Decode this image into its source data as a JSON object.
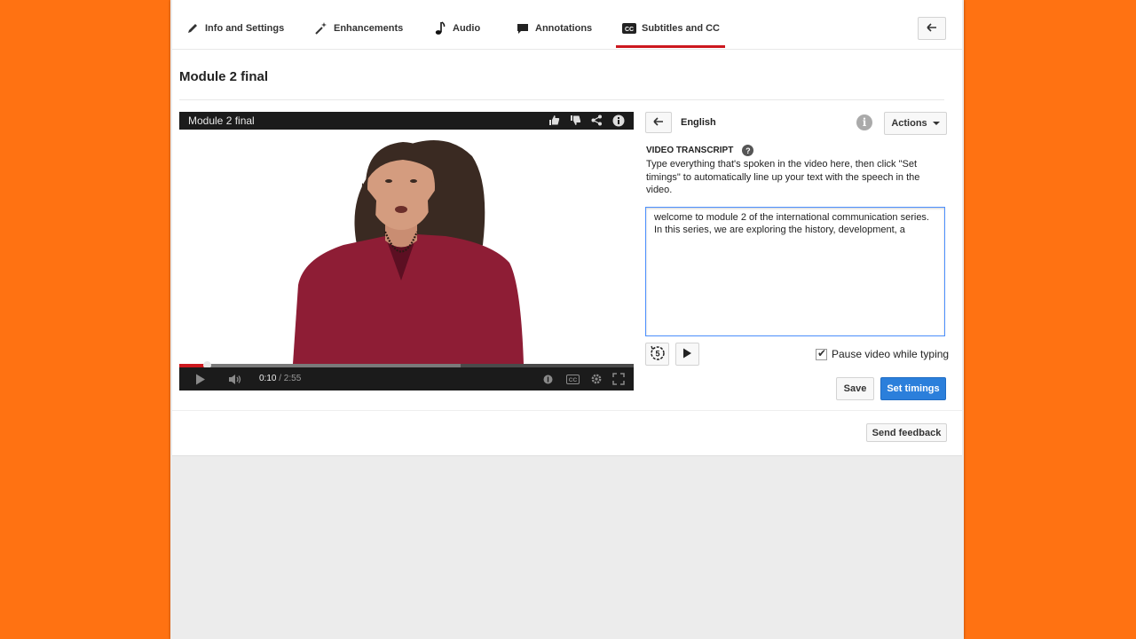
{
  "tabs": [
    {
      "label": "Info and Settings",
      "icon": "pencil-icon"
    },
    {
      "label": "Enhancements",
      "icon": "magic-wand-icon"
    },
    {
      "label": "Audio",
      "icon": "music-note-icon"
    },
    {
      "label": "Annotations",
      "icon": "speech-bubble-icon"
    },
    {
      "label": "Subtitles and CC",
      "icon": "cc-icon"
    }
  ],
  "active_tab": "Subtitles and CC",
  "page_title": "Module 2 final",
  "player": {
    "title": "Module 2 final",
    "current_time": "0:10",
    "duration": "/ 2:55",
    "progress_fraction": 0.06,
    "buffered_fraction": 0.62
  },
  "subtitle_panel": {
    "language": "English",
    "actions_label": "Actions",
    "section_label": "VIDEO TRANSCRIPT",
    "description": "Type everything that's spoken in the video here, then click \"Set timings\" to automatically line up your text with the speech in the video.",
    "transcript_text": "welcome to module 2 of the international communication series. In this series, we are exploring the history, development, a",
    "pause_checkbox_label": "Pause video while typing",
    "pause_checked": true,
    "save_label": "Save",
    "set_timings_label": "Set timings",
    "send_feedback_label": "Send feedback"
  },
  "colors": {
    "background": "#ff7212",
    "accent_red": "#cc181e",
    "primary_blue": "#2b7fdb"
  }
}
